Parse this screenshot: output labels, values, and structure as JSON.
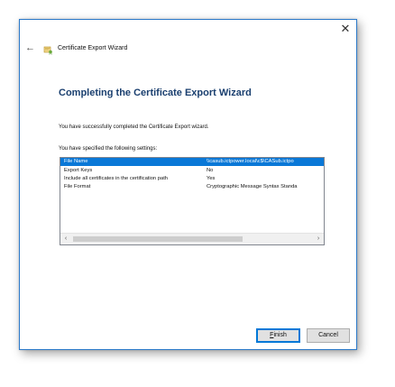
{
  "window": {
    "title": "Certificate Export Wizard",
    "close_glyph": "✕",
    "back_glyph": "←"
  },
  "page": {
    "heading": "Completing the Certificate Export Wizard",
    "intro": "You have successfully completed the Certificate Export wizard.",
    "settings_label": "You have specified the following settings:"
  },
  "settings": [
    {
      "name": "File Name",
      "value": "\\\\casub.ictpower.local\\c$\\CASub.ictpo",
      "selected": true
    },
    {
      "name": "Export Keys",
      "value": "No",
      "selected": false
    },
    {
      "name": "Include all certificates in the certification path",
      "value": "Yes",
      "selected": false
    },
    {
      "name": "File Format",
      "value": "Cryptographic Message Syntax Standa",
      "selected": false
    }
  ],
  "scrollbar": {
    "left_glyph": "‹",
    "right_glyph": "›"
  },
  "buttons": {
    "finish_access_key": "F",
    "finish_rest": "inish",
    "cancel": "Cancel"
  },
  "icons": {
    "wizard": "certificate-wizard-icon",
    "back": "back-arrow-icon",
    "close": "close-icon"
  },
  "colors": {
    "accent": "#0a78d7",
    "heading": "#1a3f6f",
    "border": "#2b79c9"
  }
}
